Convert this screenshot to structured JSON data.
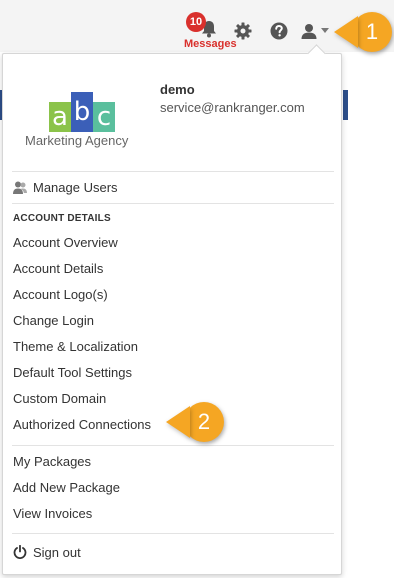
{
  "header": {
    "notifications": {
      "count": "10",
      "label": "Messages",
      "icon": "bell-icon"
    },
    "settings_icon": "gear-icon",
    "help_icon": "help-icon",
    "user_icon": "user-icon"
  },
  "callouts": {
    "first": "1",
    "second": "2"
  },
  "profile": {
    "logo_text": "Marketing Agency",
    "logo_letters": [
      "a",
      "b",
      "c"
    ],
    "username": "demo",
    "email": "service@rankranger.com"
  },
  "menu": {
    "manage_users": "Manage Users",
    "account_details_heading": "ACCOUNT DETAILS",
    "account_items": [
      "Account Overview",
      "Account Details",
      "Account Logo(s)",
      "Change Login",
      "Theme & Localization",
      "Default Tool Settings",
      "Custom Domain",
      "Authorized Connections"
    ],
    "package_items": [
      "My Packages",
      "Add New Package",
      "View Invoices"
    ],
    "sign_out": "Sign out"
  },
  "colors": {
    "badge": "#d9302c",
    "callout": "#f5a623",
    "logo_a": "#8bc34a",
    "logo_b": "#3b5fb8",
    "logo_c": "#5abf9d"
  }
}
